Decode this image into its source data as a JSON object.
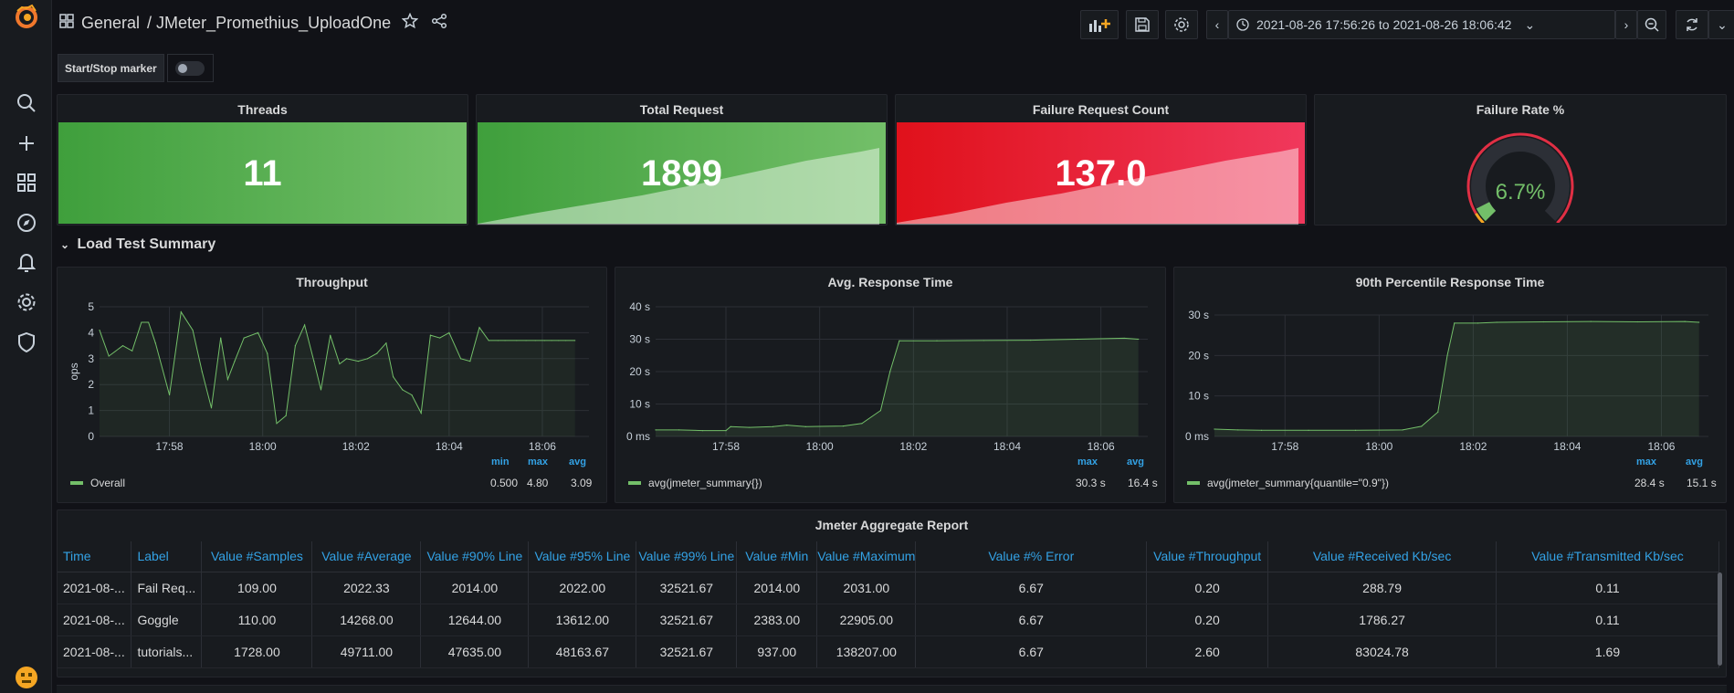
{
  "header": {
    "breadcrumb_folder": "General",
    "breadcrumb_dashboard": "/ JMeter_Promethius_UploadOne",
    "time_range": "2021-08-26 17:56:26 to 2021-08-26 18:06:42"
  },
  "marker": {
    "label": "Start/Stop marker"
  },
  "stats": [
    {
      "title": "Threads",
      "value": "11"
    },
    {
      "title": "Total Request",
      "value": "1899"
    },
    {
      "title": "Failure Request Count",
      "value": "137.0"
    },
    {
      "title": "Failure Rate %",
      "value": "6.7%",
      "gauge_fraction": 0.067
    }
  ],
  "section": {
    "title": "Load Test Summary"
  },
  "colors": {
    "green": "#73bf69",
    "red": "#e02f44",
    "blue": "#33a2e5",
    "bg": "#111217",
    "panel": "#181b1f"
  },
  "charts": {
    "throughput": {
      "title": "Throughput",
      "ylabel": "ops",
      "legend_heads": [
        "min",
        "max",
        "avg"
      ],
      "legend_series": "Overall",
      "legend_values": [
        "0.500",
        "4.80",
        "3.09"
      ]
    },
    "avg": {
      "title": "Avg. Response Time",
      "legend_heads": [
        "max",
        "avg"
      ],
      "legend_series": "avg(jmeter_summary{})",
      "legend_values": [
        "30.3 s",
        "16.4 s"
      ]
    },
    "p90": {
      "title": "90th Percentile Response Time",
      "legend_heads": [
        "max",
        "avg"
      ],
      "legend_series": "avg(jmeter_summary{quantile=\"0.9\"})",
      "legend_values": [
        "28.4 s",
        "15.1 s"
      ]
    }
  },
  "chart_data": [
    {
      "type": "line",
      "title": "Throughput",
      "ylabel": "ops",
      "ylim": [
        0,
        5
      ],
      "yticks": [
        "0",
        "1",
        "2",
        "3",
        "4",
        "5"
      ],
      "xticks": [
        "17:58",
        "18:00",
        "18:02",
        "18:04",
        "18:06"
      ],
      "xlim": [
        0,
        10.5
      ],
      "x": [
        0,
        0.2,
        0.5,
        0.7,
        0.9,
        1.05,
        1.2,
        1.5,
        1.75,
        2.0,
        2.2,
        2.4,
        2.6,
        2.75,
        2.9,
        3.1,
        3.4,
        3.6,
        3.8,
        4.0,
        4.2,
        4.4,
        4.6,
        4.75,
        4.95,
        5.15,
        5.3,
        5.55,
        5.75,
        5.95,
        6.15,
        6.3,
        6.5,
        6.7,
        6.9,
        7.1,
        7.3,
        7.5,
        7.75,
        7.95,
        8.15,
        8.35,
        8.55,
        8.7,
        8.95,
        9.15,
        9.35,
        9.55,
        9.7,
        9.85,
        10.0,
        10.2
      ],
      "series": [
        {
          "name": "Overall",
          "values": [
            4.1,
            3.1,
            3.5,
            3.3,
            4.4,
            4.4,
            3.6,
            1.6,
            4.8,
            4.1,
            2.5,
            1.1,
            3.8,
            2.2,
            2.9,
            3.8,
            4.0,
            3.2,
            0.5,
            0.8,
            3.5,
            4.3,
            2.9,
            1.8,
            3.9,
            2.8,
            3.0,
            2.9,
            3.0,
            3.2,
            3.6,
            2.3,
            1.8,
            1.6,
            0.9,
            3.9,
            3.8,
            4.0,
            3.0,
            2.9,
            4.2,
            3.7,
            3.7,
            3.7,
            3.7,
            3.7,
            3.7,
            3.7,
            3.7,
            3.7,
            3.7,
            3.7
          ]
        }
      ]
    },
    {
      "type": "area",
      "title": "Avg. Response Time",
      "ylim": [
        0,
        40
      ],
      "yticks": [
        "0 ms",
        "10 s",
        "20 s",
        "30 s",
        "40 s"
      ],
      "xticks": [
        "17:58",
        "18:00",
        "18:02",
        "18:04",
        "18:06"
      ],
      "xlim": [
        0,
        10.5
      ],
      "x": [
        0,
        0.5,
        1.0,
        1.5,
        1.6,
        2.0,
        2.5,
        2.8,
        3.2,
        4.0,
        4.4,
        4.8,
        5.0,
        5.2,
        6.0,
        7.0,
        8.0,
        9.0,
        10.0,
        10.3
      ],
      "series": [
        {
          "name": "avg(jmeter_summary{})",
          "values": [
            2.0,
            2.0,
            1.8,
            1.8,
            3.0,
            2.8,
            3.0,
            3.5,
            3.0,
            3.2,
            4.0,
            8.0,
            20.0,
            29.5,
            29.5,
            29.6,
            29.7,
            30.0,
            30.3,
            30.0
          ]
        }
      ]
    },
    {
      "type": "area",
      "title": "90th Percentile Response Time",
      "ylim": [
        0,
        30
      ],
      "yticks": [
        "0 ms",
        "10 s",
        "20 s",
        "30 s"
      ],
      "xticks": [
        "17:58",
        "18:00",
        "18:02",
        "18:04",
        "18:06"
      ],
      "xlim": [
        0,
        10.5
      ],
      "x": [
        0,
        0.5,
        1.0,
        2.0,
        3.0,
        4.0,
        4.4,
        4.75,
        4.95,
        5.1,
        5.6,
        6.0,
        7.0,
        8.0,
        9.0,
        10.0,
        10.3
      ],
      "series": [
        {
          "name": "avg(jmeter_summary{quantile=\"0.9\"})",
          "values": [
            1.8,
            1.6,
            1.5,
            1.5,
            1.5,
            1.6,
            2.5,
            6.0,
            20.0,
            28.0,
            28.0,
            28.2,
            28.3,
            28.4,
            28.3,
            28.4,
            28.2
          ]
        }
      ]
    }
  ],
  "table": {
    "title": "Jmeter Aggregate Report",
    "columns": [
      "Time",
      "Label",
      "Value #Samples",
      "Value #Average",
      "Value #90% Line",
      "Value #95% Line",
      "Value #99% Line",
      "Value #Min",
      "Value #Maximum",
      "Value #% Error",
      "Value #Throughput",
      "Value #Received Kb/sec",
      "Value #Transmitted Kb/sec"
    ],
    "rows": [
      [
        "2021-08-...",
        "Fail Req...",
        "109.00",
        "2022.33",
        "2014.00",
        "2022.00",
        "32521.67",
        "2014.00",
        "2031.00",
        "6.67",
        "0.20",
        "288.79",
        "0.11"
      ],
      [
        "2021-08-...",
        "Goggle",
        "110.00",
        "14268.00",
        "12644.00",
        "13612.00",
        "32521.67",
        "2383.00",
        "22905.00",
        "6.67",
        "0.20",
        "1786.27",
        "0.11"
      ],
      [
        "2021-08-...",
        "tutorials...",
        "1728.00",
        "49711.00",
        "47635.00",
        "48163.67",
        "32521.67",
        "937.00",
        "138207.00",
        "6.67",
        "2.60",
        "83024.78",
        "1.69"
      ]
    ]
  }
}
